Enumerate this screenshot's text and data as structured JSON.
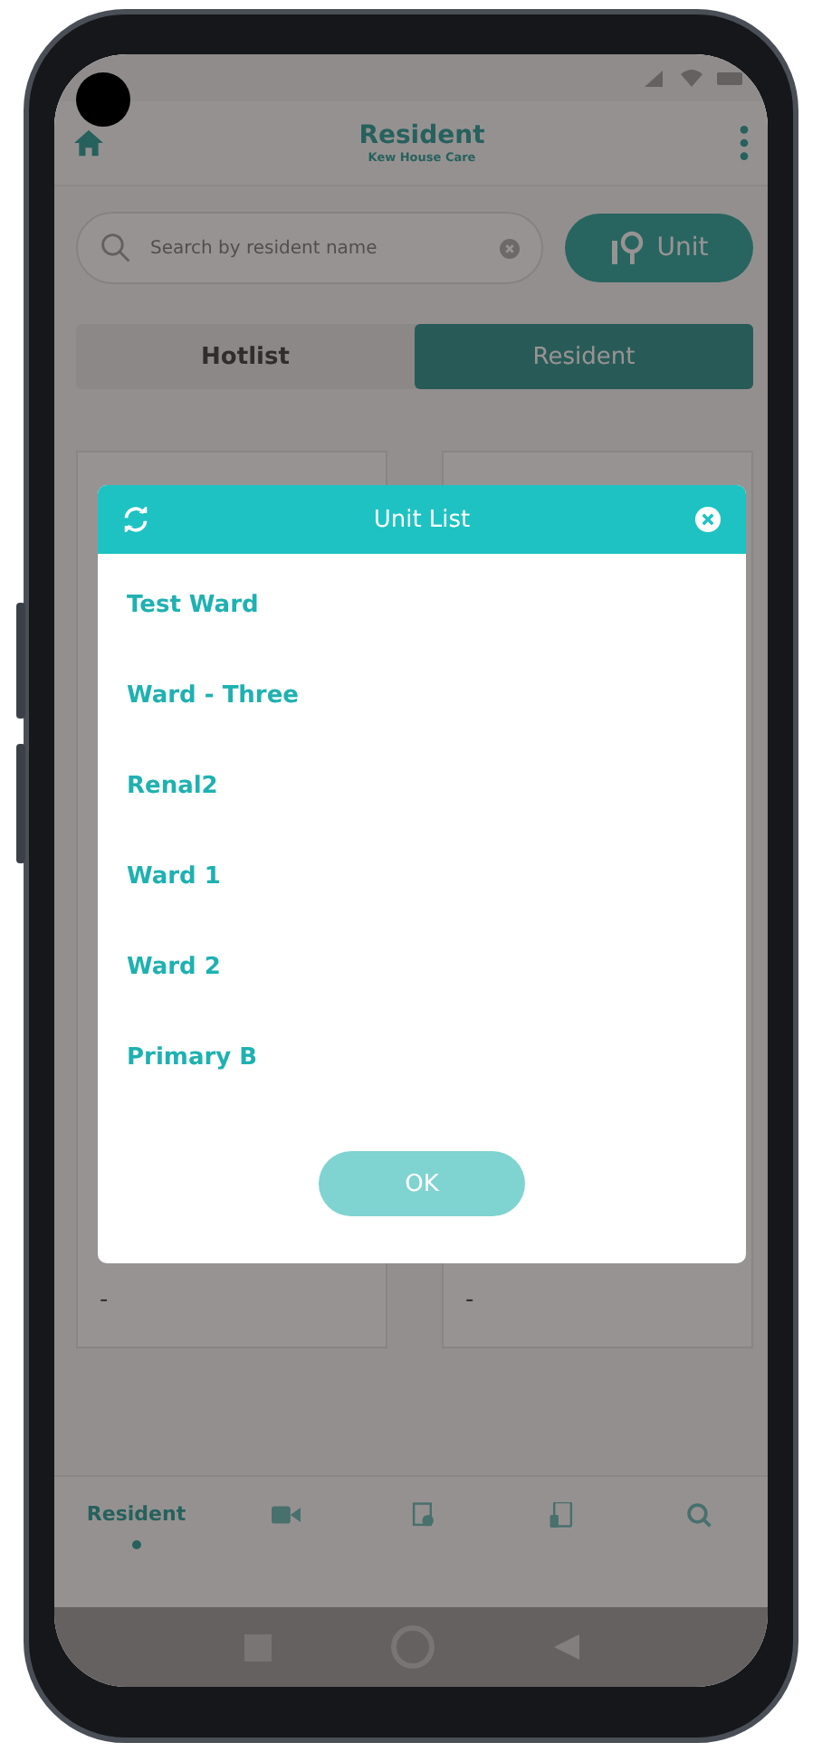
{
  "header": {
    "title": "Resident",
    "subtitle": "Kew House Care"
  },
  "search": {
    "placeholder": "Search by resident name"
  },
  "unit_button": {
    "label": "Unit"
  },
  "tabs": [
    {
      "label": "Hotlist",
      "selected": false
    },
    {
      "label": "Resident",
      "selected": true
    }
  ],
  "cards": [
    {
      "value": "-"
    },
    {
      "value": "-"
    }
  ],
  "dialog": {
    "title": "Unit List",
    "units": [
      "Test Ward",
      "Ward - Three",
      "Renal2",
      "Ward 1",
      "Ward 2",
      "Primary B"
    ],
    "ok": "OK"
  },
  "bottom_nav": [
    {
      "kind": "label",
      "label": "Resident",
      "selected": true
    },
    {
      "kind": "video",
      "selected": false
    },
    {
      "kind": "document",
      "selected": false
    },
    {
      "kind": "tablet",
      "selected": false
    },
    {
      "kind": "search",
      "selected": false
    }
  ]
}
